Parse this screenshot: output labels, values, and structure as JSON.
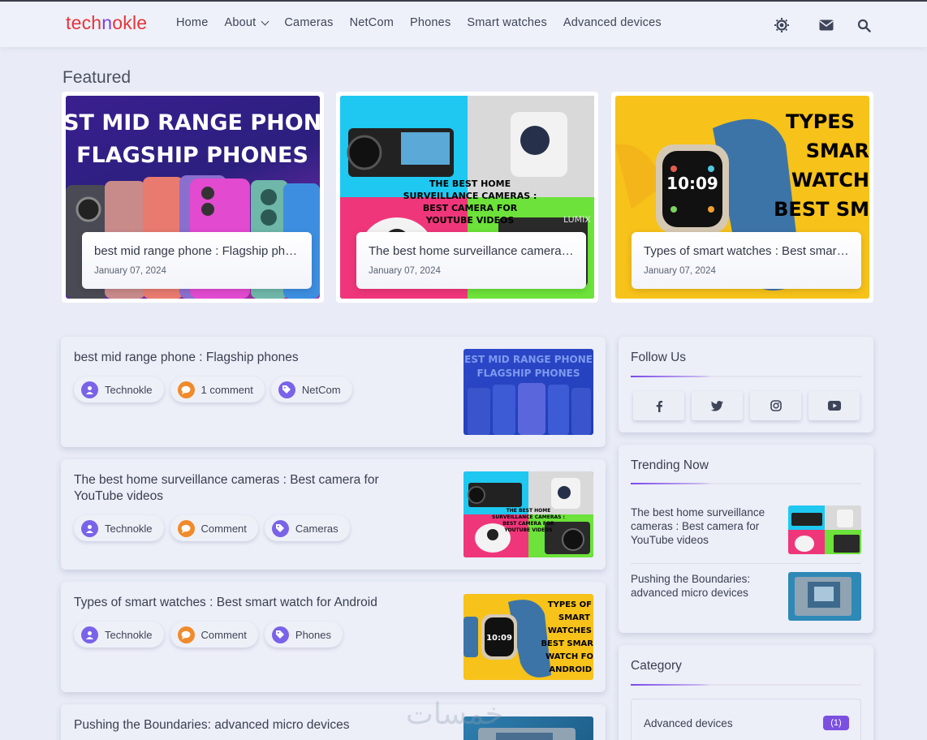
{
  "site": {
    "logo_part1": "tech",
    "logo_part2": "n",
    "logo_part3": "okle"
  },
  "nav": [
    "Home",
    "About",
    "Cameras",
    "NetCom",
    "Phones",
    "Smart watches",
    "Advanced devices"
  ],
  "featured": {
    "heading": "Featured",
    "cards": [
      {
        "title": "best mid range phone : Flagship phones",
        "date": "January 07, 2024",
        "img_line1": "BEST MID RANGE PHONE :",
        "img_line2": "FLAGSHIP PHONES"
      },
      {
        "title": "The best home surveillance cameras : Best camera for YouTube videos",
        "date": "January 07, 2024",
        "img_text": "THE BEST HOME SURVEILLANCE CAMERAS : BEST CAMERA FOR YOUTUBE VIDEOS",
        "img_brand": "LUMIX"
      },
      {
        "title": "Types of smart watches : Best smart watch for Android",
        "date": "January 07, 2024",
        "img_text": "TYPES OF SMART WATCHES BEST SMART WATCH FOR ANDROID",
        "img_time": "10:09"
      }
    ]
  },
  "posts": [
    {
      "title": "best mid range phone : Flagship phones",
      "author": "Technokle",
      "comments": "1 comment",
      "label": "NetCom"
    },
    {
      "title": "The best home surveillance cameras : Best camera for YouTube videos",
      "author": "Technokle",
      "comments": "Comment",
      "label": "Cameras"
    },
    {
      "title": "Types of smart watches : Best smart watch for Android",
      "author": "Technokle",
      "comments": "Comment",
      "label": "Phones"
    },
    {
      "title": "Pushing the Boundaries: advanced micro devices"
    }
  ],
  "sidebar": {
    "follow_title": "Follow Us",
    "social": [
      "facebook-icon",
      "twitter-icon",
      "instagram-icon",
      "youtube-icon"
    ],
    "trending_title": "Trending Now",
    "trending": [
      {
        "title": "The best home surveillance cameras : Best camera for YouTube videos"
      },
      {
        "title": "Pushing the Boundaries: advanced micro devices"
      }
    ],
    "category_title": "Category",
    "categories": [
      {
        "name": "Advanced devices",
        "count": "(1)"
      }
    ]
  },
  "watermark": "خمسات",
  "colors": {
    "accent": "#7b4fe0",
    "logo_red": "#e6343a",
    "bg": "#e9ecf6"
  }
}
